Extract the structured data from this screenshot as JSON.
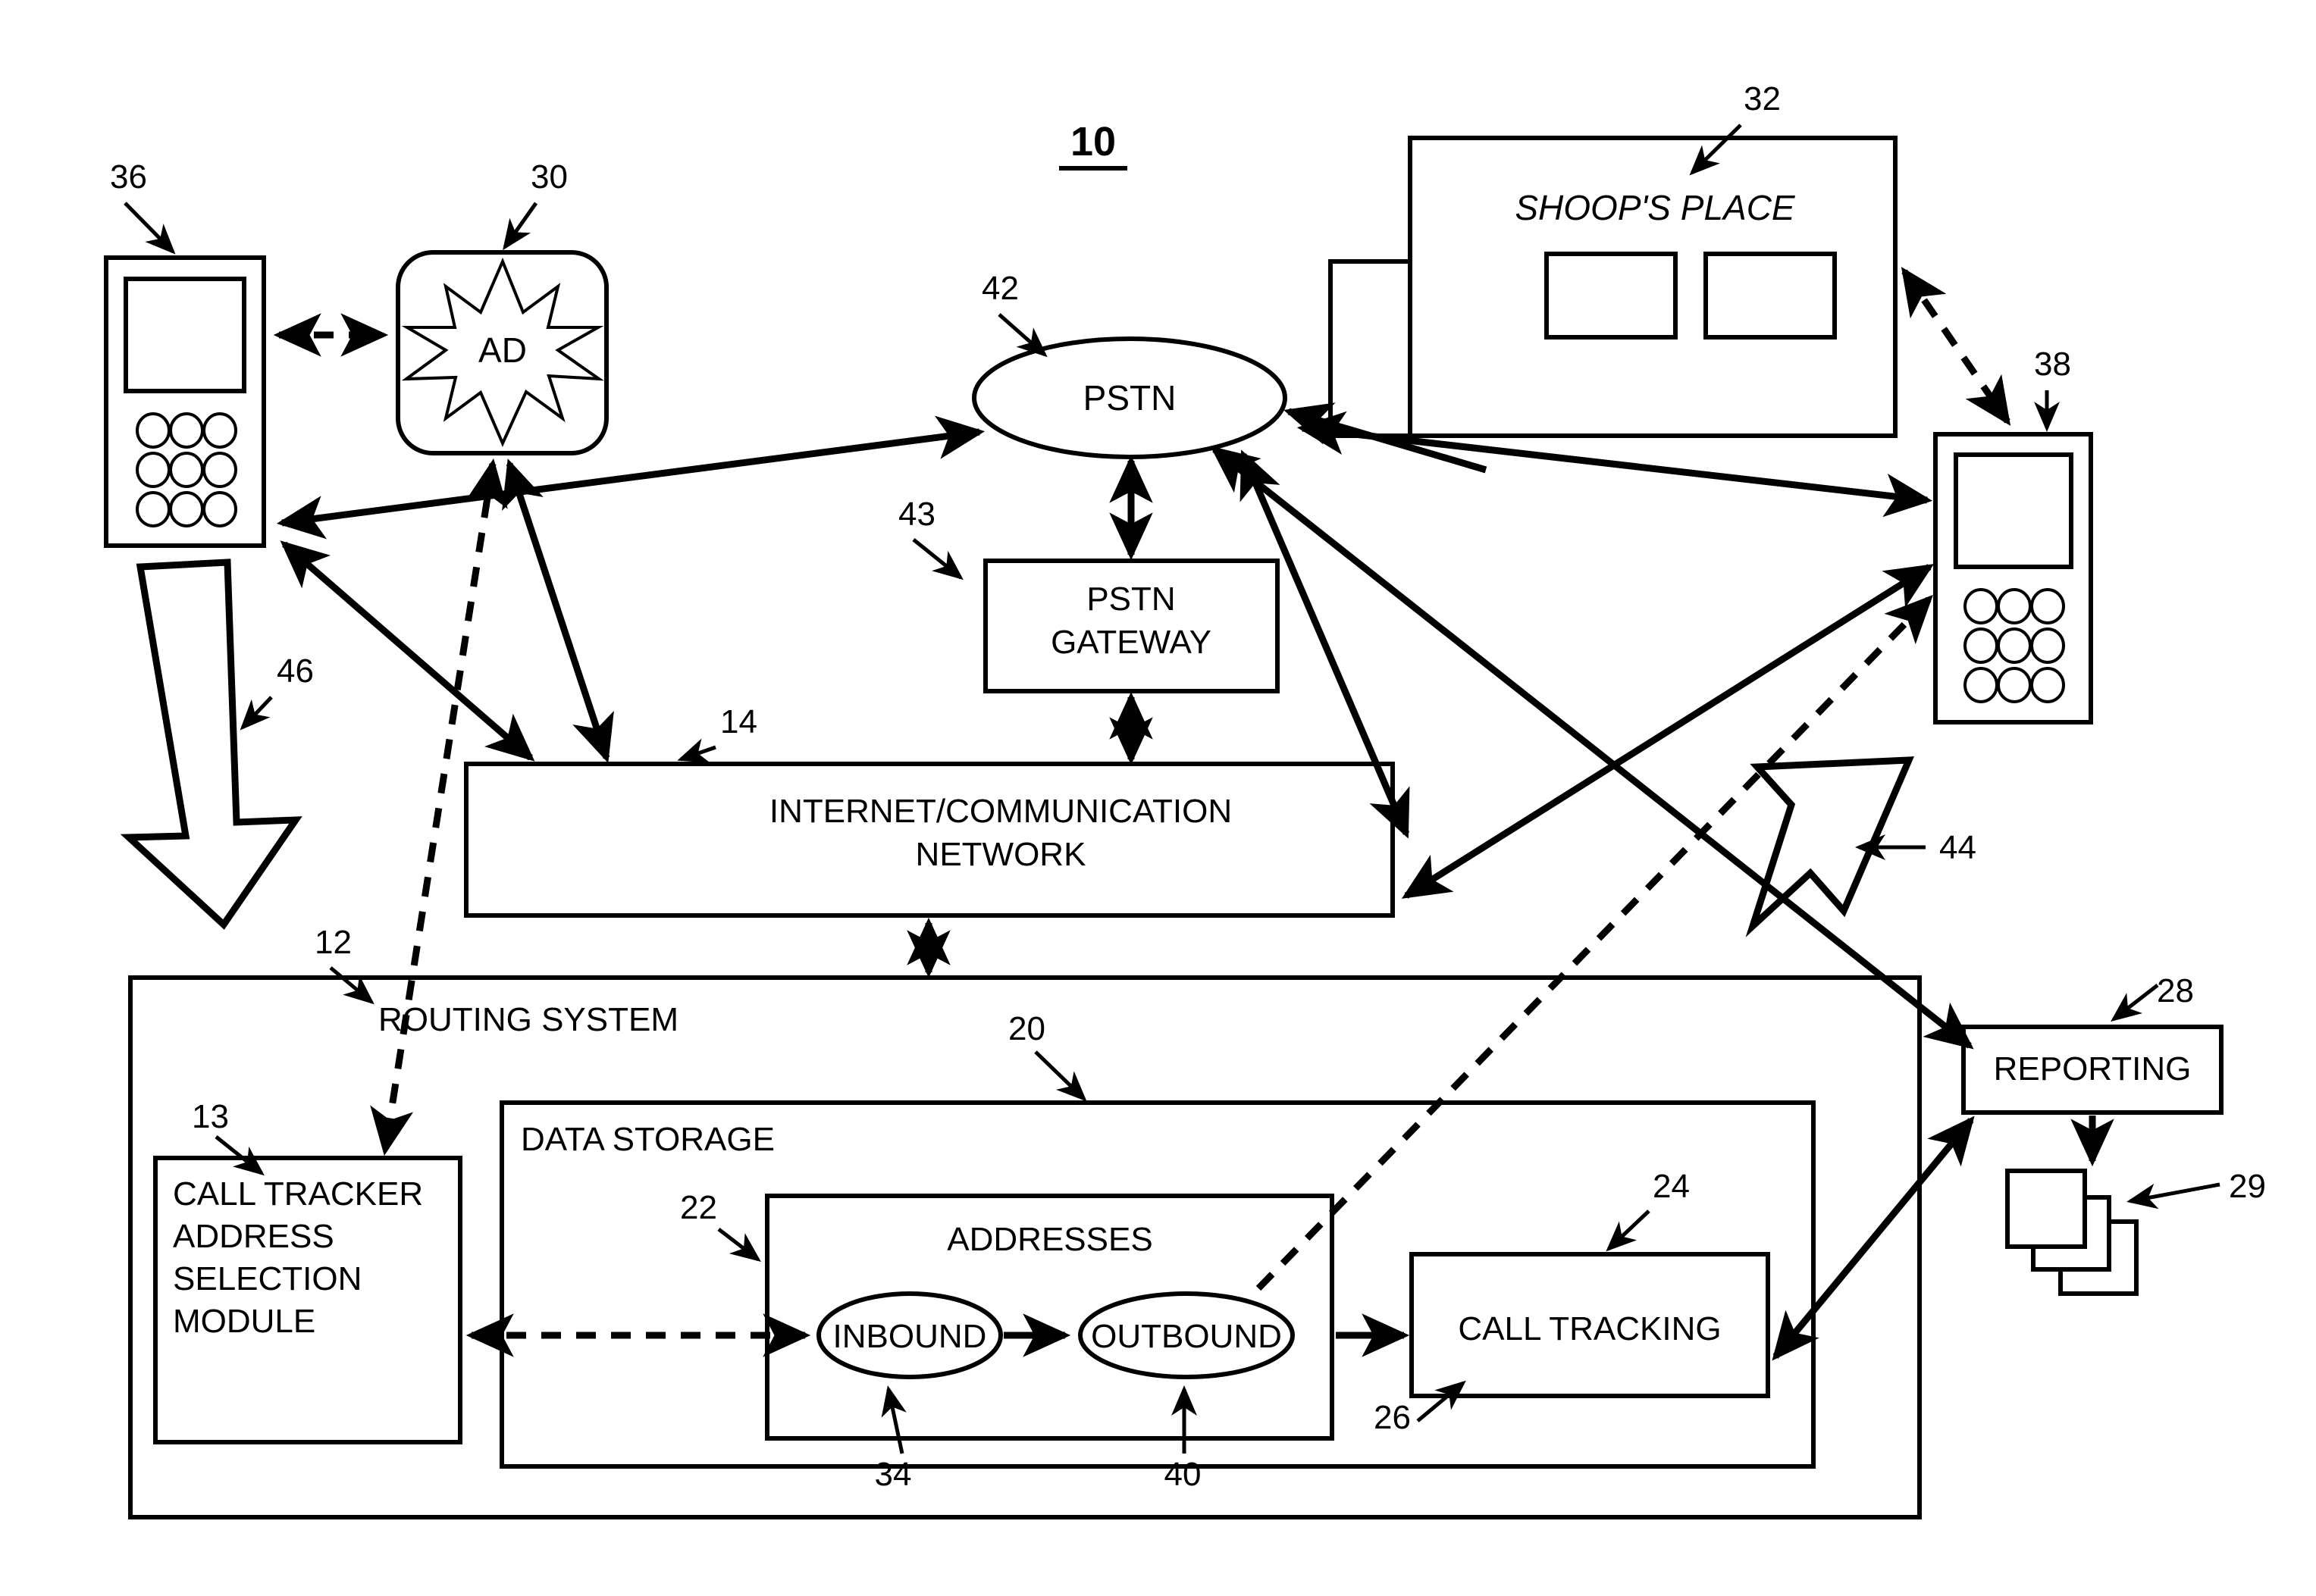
{
  "figure": {
    "title": "10",
    "background_color": "#ffffff",
    "line_color": "#000000"
  },
  "nodes": {
    "mobile_phone_left": {
      "ref": "36",
      "name": "mobile-phone"
    },
    "ad": {
      "ref": "30",
      "label": "AD"
    },
    "pstn": {
      "ref": "42",
      "label": "PSTN"
    },
    "pstn_gateway": {
      "ref": "43",
      "label_line1": "PSTN",
      "label_line2": "GATEWAY"
    },
    "business": {
      "ref": "32",
      "sign": "SHOOP'S PLACE"
    },
    "mobile_phone_right": {
      "ref": "38",
      "name": "mobile-phone"
    },
    "network": {
      "ref": "14",
      "label_line1": "INTERNET/COMMUNICATION",
      "label_line2": "NETWORK"
    },
    "routing_system": {
      "ref": "12",
      "label": "ROUTING SYSTEM"
    },
    "call_tracker_module": {
      "ref": "13",
      "line1": "CALL TRACKER",
      "line2": "ADDRESS",
      "line3": "SELECTION",
      "line4": "MODULE"
    },
    "data_storage": {
      "ref": "20",
      "label": "DATA STORAGE"
    },
    "addresses": {
      "ref": "22",
      "label": "ADDRESSES"
    },
    "inbound": {
      "ref": "34",
      "label": "INBOUND"
    },
    "outbound": {
      "ref": "40",
      "label": "OUTBOUND"
    },
    "call_tracking": {
      "ref": "24",
      "label": "CALL TRACKING"
    },
    "call_tracking_region": {
      "ref": "26"
    },
    "reporting": {
      "ref": "28",
      "label": "REPORTING"
    },
    "reports": {
      "ref": "29",
      "name": "stacked-documents"
    },
    "block_arrow_down": {
      "ref": "46"
    },
    "block_arrow_up": {
      "ref": "44"
    }
  },
  "reference_numerals": [
    "10",
    "12",
    "13",
    "14",
    "20",
    "22",
    "24",
    "26",
    "28",
    "29",
    "30",
    "32",
    "34",
    "36",
    "38",
    "40",
    "42",
    "43",
    "44",
    "46"
  ]
}
